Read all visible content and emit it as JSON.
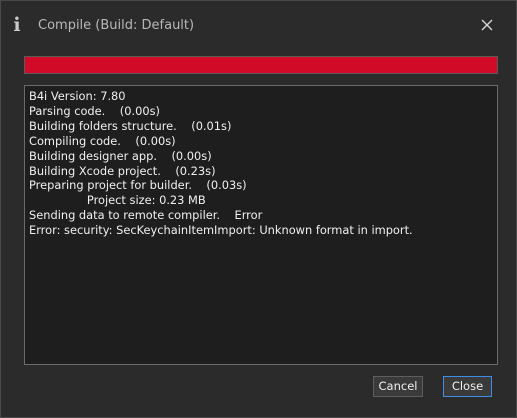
{
  "window": {
    "title": "Compile (Build: Default)",
    "icon": "info-icon",
    "icon_glyph": "i"
  },
  "progress": {
    "value_fraction": 1.0,
    "color": "#d10a28"
  },
  "log": {
    "lines": [
      "B4i Version: 7.80",
      "Parsing code.    (0.00s)",
      "Building folders structure.    (0.01s)",
      "Compiling code.    (0.00s)",
      "Building designer app.    (0.00s)",
      "Building Xcode project.    (0.23s)",
      "Preparing project for builder.    (0.03s)",
      "                Project size: 0.23 MB",
      "Sending data to remote compiler.    Error",
      "Error: security: SecKeychainItemImport: Unknown format in import."
    ]
  },
  "buttons": {
    "cancel_label": "Cancel",
    "close_label": "Close"
  },
  "colors": {
    "accent_focus": "#3e8ee6",
    "progress_red": "#d10a28"
  }
}
